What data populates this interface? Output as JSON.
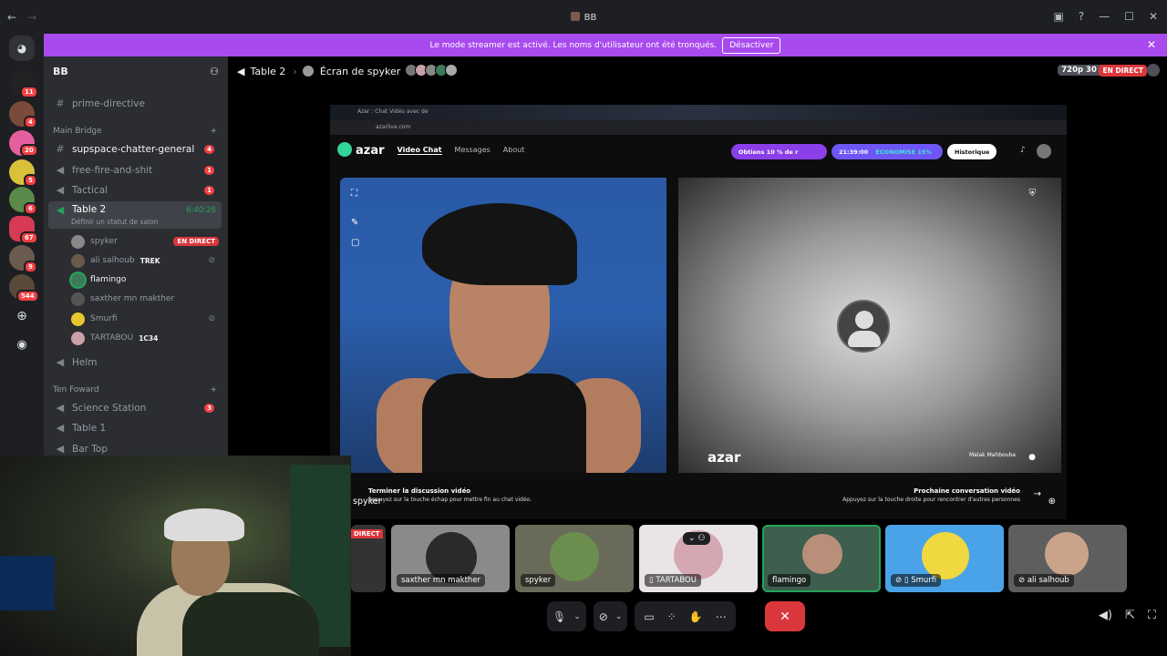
{
  "window": {
    "title": "BB",
    "back": "←",
    "forward": "→"
  },
  "banner": {
    "text": "Le mode streamer est activé. Les noms d'utilisateur ont été tronqués.",
    "button": "Désactiver"
  },
  "guilds": {
    "badges": [
      "11",
      "4",
      "20",
      "5",
      "6",
      "67",
      "9",
      "544"
    ]
  },
  "server": {
    "name": "BB",
    "top_channel": "prime-directive",
    "category1": "Main Bridge",
    "channels": [
      {
        "name": "supspace-chatter-general",
        "count": "4"
      },
      {
        "name": "free-fire-and-shit",
        "count": "1"
      },
      {
        "name": "Tactical",
        "count": "1"
      }
    ],
    "active_voice": {
      "name": "Table 2",
      "time": "6:40:26",
      "status": "Définir un statut de salon"
    },
    "users": [
      {
        "name": "spyker",
        "live": "EN DIRECT"
      },
      {
        "name": "ali salhoub",
        "tag": "TREK"
      },
      {
        "name": "flamingo"
      },
      {
        "name": "saxther mn makther"
      },
      {
        "name": "Smurfi"
      },
      {
        "name": "TARTABOU",
        "tag": "1C34"
      }
    ],
    "helm": "Helm",
    "category2": "Ten Foward",
    "channels2": [
      {
        "name": "Science Station",
        "count": "3"
      },
      {
        "name": "Table 1"
      },
      {
        "name": "Bar Top"
      }
    ]
  },
  "header": {
    "channel": "Table 2",
    "screen": "Écran de spyker",
    "fps": "720p 30 FPS",
    "live": "EN DIRECT"
  },
  "stream": {
    "tab": "Azar : Chat Vidéo avec de",
    "url": "azarlive.com",
    "nav": [
      "Video Chat",
      "Messages",
      "About"
    ],
    "promo": "Obtiens 10 % de r",
    "timer": "21:39:00",
    "save": "ÉCONOMISE 15%",
    "history": "Historique",
    "brand": "azar",
    "peer": "Malak Mahbouba",
    "end_title": "Terminer la discussion vidéo",
    "end_sub": "Appuyez sur la touche échap pour mettre fin au chat vidéo.",
    "next_title": "Prochaine conversation vidéo",
    "next_sub": "Appuyez sur la touche droite pour rencontrer d'autres personnes"
  },
  "webcam": {
    "label": "spyker"
  },
  "tiles": {
    "partial": "DIRECT",
    "items": [
      {
        "name": "saxther mn makther"
      },
      {
        "name": "spyker"
      },
      {
        "name": "TARTABOU"
      },
      {
        "name": "flamingo"
      },
      {
        "name": "Smurfi"
      },
      {
        "name": "ali salhoub"
      }
    ]
  },
  "colors": {
    "accent": "#a94aee",
    "live": "#da373c",
    "online": "#23a55a"
  }
}
